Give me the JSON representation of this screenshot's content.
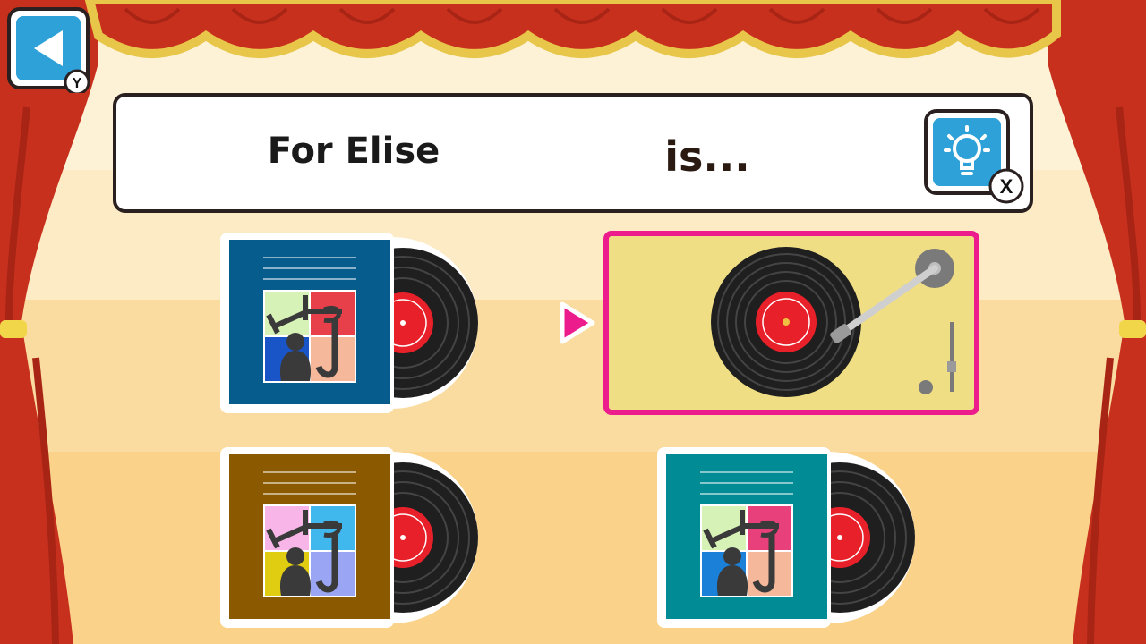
{
  "prompt": {
    "title": "For Elise",
    "suffix": "is..."
  },
  "controls": {
    "back": {
      "icon": "back-arrow-icon",
      "button_hint": "Y"
    },
    "hint": {
      "icon": "lightbulb-icon",
      "button_hint": "X"
    }
  },
  "options": [
    {
      "id": "option-1",
      "cover_color": "#075c8e",
      "quad_colors": [
        "#d7f2b6",
        "#e8404a",
        "#1a55c8",
        "#f6b89a"
      ],
      "state": "unselected"
    },
    {
      "id": "option-2",
      "type": "turntable",
      "state": "selected"
    },
    {
      "id": "option-3",
      "cover_color": "#8b5a00",
      "quad_colors": [
        "#f7b6e7",
        "#40b8ee",
        "#e0cc10",
        "#9aa6f4"
      ],
      "state": "unselected"
    },
    {
      "id": "option-4",
      "cover_color": "#008b95",
      "quad_colors": [
        "#d7f2b6",
        "#e8407a",
        "#1a80d8",
        "#f6b89a"
      ],
      "state": "unselected"
    }
  ],
  "colors": {
    "selection": "#ec1c8c",
    "curtain": "#c8301e",
    "valance_trim": "#e8c64a",
    "turntable_base": "#f0de84"
  }
}
